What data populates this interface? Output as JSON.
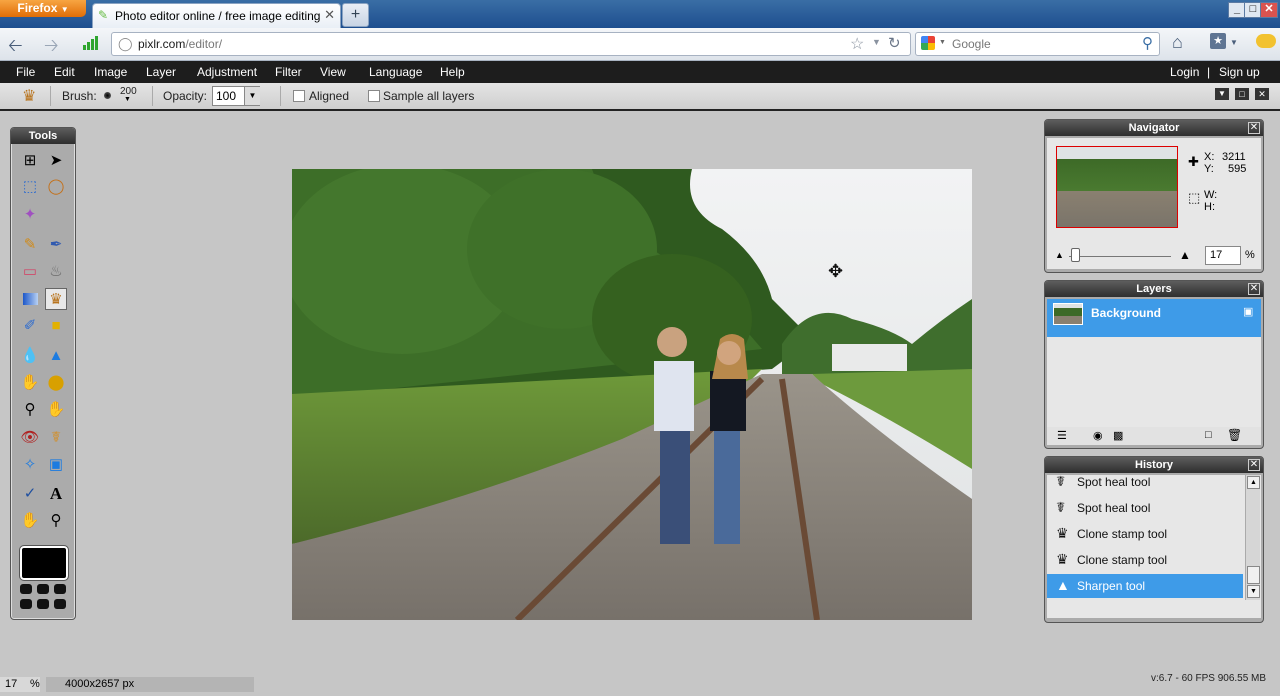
{
  "browser": {
    "menu_button": "Firefox",
    "tab_title": "Photo editor online / free image editing direct i...",
    "new_tab": "+",
    "url_domain": "pixlr.com",
    "url_path": "/editor/",
    "search_placeholder": "Google",
    "window_controls": [
      "_",
      "□",
      "✕"
    ]
  },
  "menubar": {
    "items": [
      "File",
      "Edit",
      "Image",
      "Layer",
      "Adjustment",
      "Filter",
      "View",
      "Language",
      "Help"
    ],
    "login": "Login",
    "separator": "|",
    "signup": "Sign up"
  },
  "options": {
    "brush_label": "Brush:",
    "brush_size": "200",
    "opacity_label": "Opacity:",
    "opacity_value": "100",
    "aligned_label": "Aligned",
    "sample_label": "Sample all layers"
  },
  "tools": {
    "title": "Tools",
    "icons": [
      "crop-icon",
      "move-icon",
      "marquee-icon",
      "lasso-icon",
      "wand-icon",
      "pencil-icon",
      "brush-icon",
      "eraser-icon",
      "bucket-icon",
      "gradient-icon",
      "clone-stamp-icon",
      "color-replace-icon",
      "shape-icon",
      "blur-icon",
      "sharpen-icon",
      "smudge-icon",
      "sponge-icon",
      "dodge-icon",
      "burn-icon",
      "redeye-icon",
      "spot-heal-icon",
      "bloat-icon",
      "pinch-icon",
      "picker-icon",
      "type-icon",
      "hand-icon",
      "zoom-icon"
    ],
    "foreground_color": "#000000"
  },
  "navigator": {
    "title": "Navigator",
    "x_label": "X:",
    "x_value": "3211",
    "y_label": "Y:",
    "y_value": "595",
    "w_label": "W:",
    "h_label": "H:",
    "zoom_value": "17",
    "zoom_unit": "%"
  },
  "layers": {
    "title": "Layers",
    "items": [
      {
        "name": "Background"
      }
    ]
  },
  "history": {
    "title": "History",
    "items": [
      {
        "label": "Spot heal tool",
        "icon": "bandage-icon"
      },
      {
        "label": "Spot heal tool",
        "icon": "bandage-icon"
      },
      {
        "label": "Clone stamp tool",
        "icon": "stamp-icon"
      },
      {
        "label": "Clone stamp tool",
        "icon": "stamp-icon"
      },
      {
        "label": "Sharpen tool",
        "icon": "sharpen-icon",
        "selected": true
      }
    ]
  },
  "status": {
    "zoom": "17",
    "zoom_unit": "%",
    "dimensions": "4000x2657 px",
    "performance": "v:6.7 - 60 FPS 906.55 MB"
  },
  "colors": {
    "accent": "#3e9be8",
    "menubar": "#1d1d1d",
    "panel_header": "#3a3a3a"
  }
}
